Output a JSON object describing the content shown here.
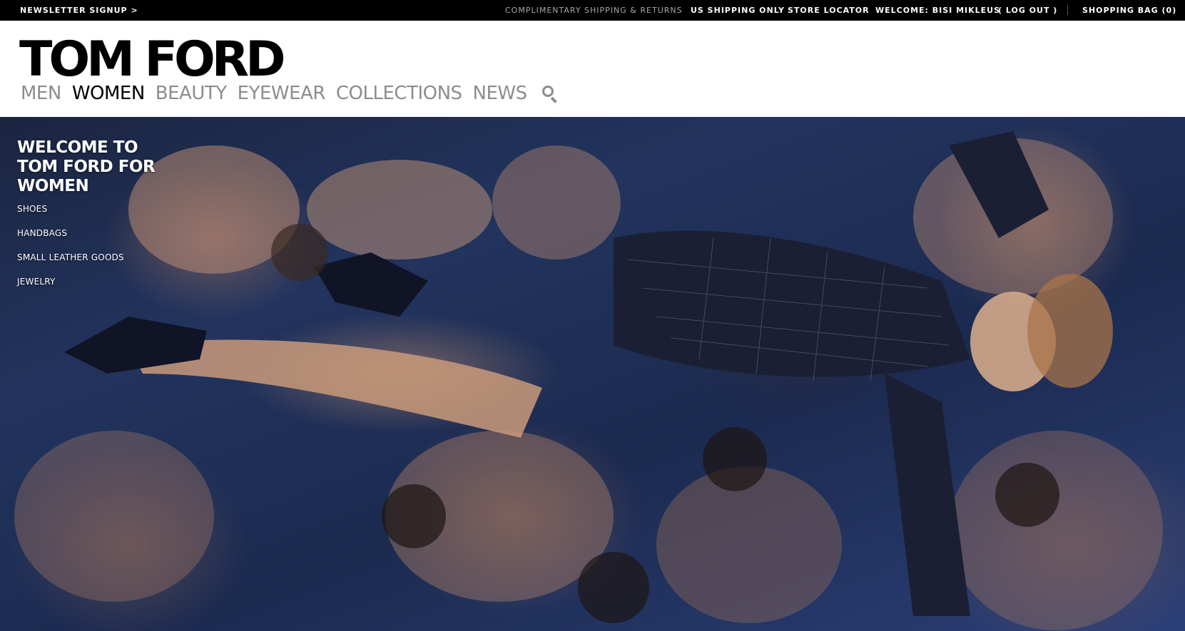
{
  "topbar": {
    "newsletter": "NEWSLETTER SIGNUP >",
    "shipping_promo": "COMPLIMENTARY SHIPPING & RETURNS",
    "us_only": "US SHIPPING ONLY",
    "store_locator": "STORE LOCATOR",
    "welcome_user": "WELCOME: BISI MIKLEUS",
    "logout": "( LOG OUT )",
    "shopping_bag": "SHOPPING BAG (0)"
  },
  "header": {
    "logo": "TOM FORD",
    "nav": [
      {
        "label": "MEN",
        "active": false
      },
      {
        "label": "WOMEN",
        "active": true
      },
      {
        "label": "BEAUTY",
        "active": false
      },
      {
        "label": "EYEWEAR",
        "active": false
      },
      {
        "label": "COLLECTIONS",
        "active": false
      },
      {
        "label": "NEWS",
        "active": false
      }
    ],
    "search_icon": "search-icon"
  },
  "hero": {
    "heading": "WELCOME TO TOM FORD FOR WOMEN",
    "menu": [
      "SHOES",
      "HANDBAGS",
      "SMALL LEATHER GOODS",
      "JEWELRY"
    ]
  },
  "colors": {
    "topbar_bg": "#000000",
    "nav_inactive": "#8d8d8d",
    "nav_active": "#000000",
    "hero_blue": "#22345e"
  }
}
